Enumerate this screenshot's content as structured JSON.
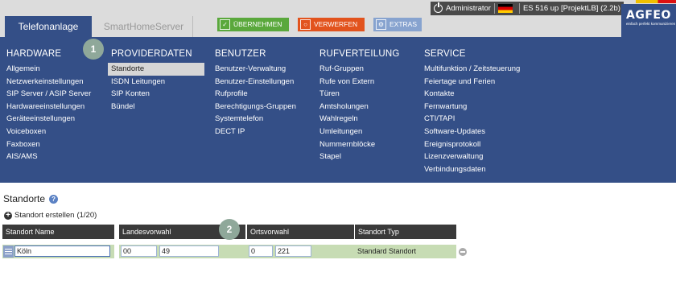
{
  "header": {
    "tabs": [
      {
        "label": "Telefonanlage",
        "active": true
      },
      {
        "label": "SmartHomeServer",
        "active": false
      }
    ],
    "actions": {
      "apply": "ÜBERNEHMEN",
      "discard": "VERWERFEN",
      "extras": "EXTRAS"
    },
    "status": {
      "user": "Administrator",
      "device": "ES 516 up [ProjektLB] (2.2b)"
    },
    "logo": {
      "word": "AGFEO",
      "claim": "einfach perfekt kommunizieren"
    }
  },
  "markers": [
    "1",
    "2"
  ],
  "menu": {
    "columns": [
      {
        "title": "HARDWARE",
        "items": [
          "Allgemein",
          "Netzwerkeinstellungen",
          "SIP Server / ASIP Server",
          "Hardwareeinstellungen",
          "Geräteeinstellungen",
          "Voiceboxen",
          "Faxboxen",
          "AIS/AMS"
        ]
      },
      {
        "title": "PROVIDERDATEN",
        "items": [
          "Standorte",
          "ISDN Leitungen",
          "SIP Konten",
          "Bündel"
        ]
      },
      {
        "title": "BENUTZER",
        "items": [
          "Benutzer-Verwaltung",
          "Benutzer-Einstellungen",
          "Rufprofile",
          "Berechtigungs-Gruppen",
          "Systemtelefon",
          "DECT IP"
        ]
      },
      {
        "title": "RUFVERTEILUNG",
        "items": [
          "Ruf-Gruppen",
          "Rufe von Extern",
          "Türen",
          "Amtsholungen",
          "Wahlregeln",
          "Umleitungen",
          "Nummernblöcke",
          "Stapel"
        ]
      },
      {
        "title": "SERVICE",
        "items": [
          "Multifunktion / Zeitsteuerung",
          "Feiertage und Ferien",
          "Kontakte",
          "Fernwartung",
          "CTI/TAPI",
          "Software-Updates",
          "Ereignisprotokoll",
          "Lizenzverwaltung",
          "Verbindungsdaten"
        ]
      }
    ]
  },
  "page": {
    "title": "Standorte",
    "add_link": "Standort erstellen",
    "add_count": "(1/20)"
  },
  "table": {
    "headers": [
      "Standort Name",
      "Landesvorwahl",
      "Ortsvorwahl",
      "Standort Typ"
    ],
    "row": {
      "name": "Köln",
      "country_prefix": "00",
      "country_code": "49",
      "area_prefix": "0",
      "area_code": "221",
      "type": "Standard Standort"
    }
  }
}
